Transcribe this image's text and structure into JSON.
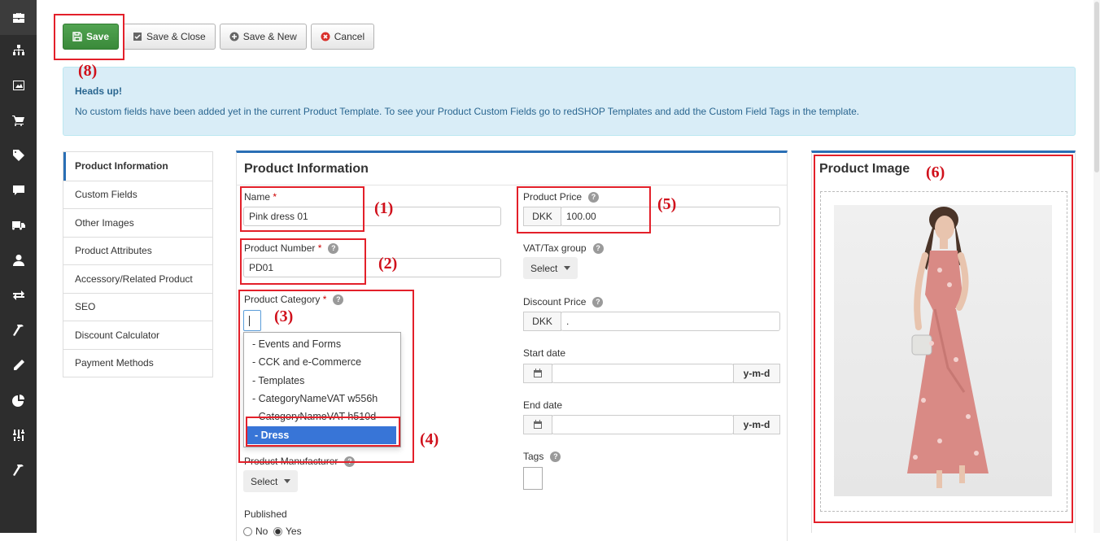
{
  "sidebar": {
    "icons": [
      "briefcase-icon",
      "sitemap-icon",
      "image-icon",
      "cart-icon",
      "tag-icon",
      "comment-icon",
      "truck-icon",
      "user-icon",
      "exchange-icon",
      "hammer-icon",
      "pencil-icon",
      "pie-chart-icon",
      "sliders-icon",
      "wrench-icon"
    ]
  },
  "toolbar": {
    "save_label": "Save",
    "save_close_label": "Save & Close",
    "save_new_label": "Save & New",
    "cancel_label": "Cancel"
  },
  "alert": {
    "heading": "Heads up!",
    "message": "No custom fields have been added yet in the current Product Template. To see your Product Custom Fields go to redSHOP Templates and add the Custom Field Tags in the template."
  },
  "tabs": [
    "Product Information",
    "Custom Fields",
    "Other Images",
    "Product Attributes",
    "Accessory/Related Product",
    "SEO",
    "Discount Calculator",
    "Payment Methods"
  ],
  "product_info": {
    "title": "Product Information",
    "name_label": "Name",
    "name_value": "Pink dress 01",
    "number_label": "Product Number",
    "number_value": "PD01",
    "category_label": "Product Category",
    "category_options": [
      "- Events and Forms",
      "- CCK and e-Commerce",
      "- Templates",
      "- CategoryNameVAT w556h",
      "- CategoryNameVAT h510d",
      "- Dress"
    ],
    "manufacturer_label": "Product Manufacturer",
    "manufacturer_value": "Select",
    "published_label": "Published",
    "published_no": "No",
    "published_yes": "Yes",
    "price_label": "Product Price",
    "currency": "DKK",
    "price_value": "100.00",
    "vat_label": "VAT/Tax group",
    "vat_value": "Select",
    "discount_label": "Discount Price",
    "discount_value": ".",
    "start_date_label": "Start date",
    "end_date_label": "End date",
    "date_format": "y-m-d",
    "tags_label": "Tags",
    "required_mark": "*",
    "help_glyph": "?"
  },
  "image_panel": {
    "title": "Product Image"
  },
  "annotations": [
    "(1)",
    "(2)",
    "(3)",
    "(4)",
    "(5)",
    "(6)",
    "(8)"
  ],
  "colors": {
    "success": "#45a045",
    "accent": "#2a6fb5",
    "annotation": "#e3202a",
    "highlight": "#3875d7"
  }
}
